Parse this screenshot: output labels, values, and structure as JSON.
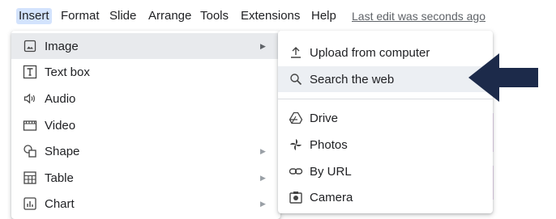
{
  "menubar": {
    "items": [
      "Insert",
      "Format",
      "Slide",
      "Arrange",
      "Tools",
      "Extensions",
      "Help"
    ],
    "last_edit": "Last edit was seconds ago"
  },
  "insert_menu": {
    "items": [
      {
        "label": "Image",
        "icon": "image-icon",
        "submenu": true,
        "highlighted": true
      },
      {
        "label": "Text box",
        "icon": "text-box-icon",
        "submenu": false
      },
      {
        "label": "Audio",
        "icon": "audio-icon",
        "submenu": false
      },
      {
        "label": "Video",
        "icon": "video-icon",
        "submenu": false
      },
      {
        "label": "Shape",
        "icon": "shape-icon",
        "submenu": true
      },
      {
        "label": "Table",
        "icon": "table-icon",
        "submenu": true
      },
      {
        "label": "Chart",
        "icon": "chart-icon",
        "submenu": true
      }
    ]
  },
  "image_submenu": {
    "items": [
      {
        "label": "Upload from computer",
        "icon": "upload-icon"
      },
      {
        "label": "Search the web",
        "icon": "search-icon",
        "highlighted": true
      },
      {
        "label": "Drive",
        "icon": "drive-icon"
      },
      {
        "label": "Photos",
        "icon": "photos-icon"
      },
      {
        "label": "By URL",
        "icon": "link-icon"
      },
      {
        "label": "Camera",
        "icon": "camera-icon"
      }
    ]
  },
  "colors": {
    "active_menu_bg": "#d3e3fd",
    "highlight_bg": "#e8eaed",
    "annotation_arrow": "#1c2a4a"
  }
}
